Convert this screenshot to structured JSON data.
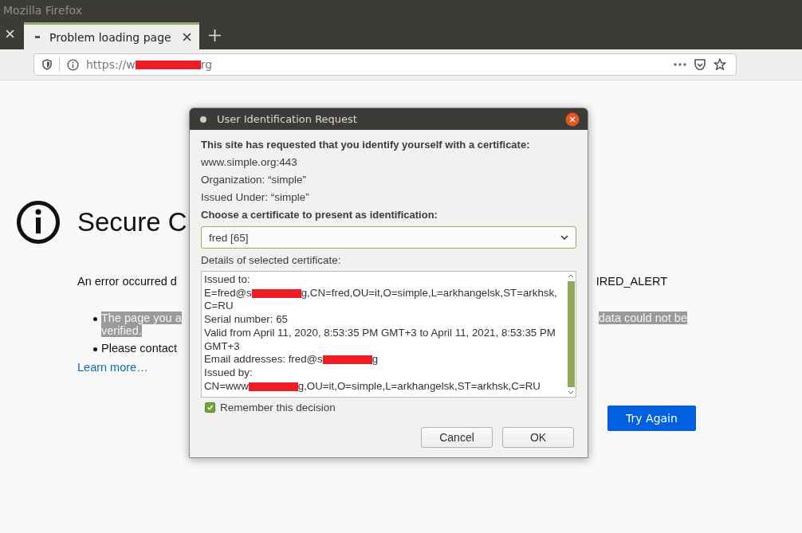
{
  "window": {
    "title": "Mozilla Firefox"
  },
  "tabs": [
    {
      "label": "Problem loading page",
      "selected": true
    }
  ],
  "url": [
    {
      "kind": "text",
      "text": "https://w"
    },
    {
      "kind": "redaction"
    },
    {
      "kind": "text",
      "text": "rg"
    }
  ],
  "page": {
    "title": "Secure C",
    "error_left": "An error occurred d",
    "error_right": "IRED_ALERT",
    "bullets": [
      {
        "left": "The page you a",
        "left_2": "verified.",
        "right": "data could not be",
        "highlighted": true
      },
      {
        "left": "Please contact",
        "highlighted": false
      }
    ],
    "link": "Learn more…",
    "button": "Try Again"
  },
  "dialog": {
    "title": "User Identification Request",
    "heading": "This site has requested that you identify yourself with a certificate:",
    "info": [
      "www.simple.org:443",
      "Organization: “simple”",
      "Issued Under: “simple”"
    ],
    "choose_label": "Choose a certificate to present as identification:",
    "certificate": "fred [65]",
    "details_label": "Details of selected certificate:",
    "details": [
      [
        {
          "kind": "text",
          "text": "Issued to:"
        }
      ],
      [
        {
          "kind": "text",
          "text": "E=fred@s"
        },
        {
          "kind": "redaction"
        },
        {
          "kind": "text",
          "text": "g,CN=fred,OU=it,O=simple,L=arkhangelsk,ST=arkhsk,C=RU"
        }
      ],
      [
        {
          "kind": "text",
          "text": "Serial number: 65"
        }
      ],
      [
        {
          "kind": "text",
          "text": "Valid from April 11, 2020, 8:53:35 PM GMT+3 to April 11, 2021, 8:53:35 PM GMT+3"
        }
      ],
      [
        {
          "kind": "text",
          "text": "Email addresses: fred@s"
        },
        {
          "kind": "redaction"
        },
        {
          "kind": "text",
          "text": "g"
        }
      ],
      [
        {
          "kind": "text",
          "text": "Issued by:"
        }
      ],
      [
        {
          "kind": "text",
          "text": "CN=www"
        },
        {
          "kind": "redaction"
        },
        {
          "kind": "text",
          "text": "g,OU=it,O=simple,L=arkhangelsk,ST=arkhsk,C=RU"
        }
      ]
    ],
    "remember": {
      "label": "Remember this decision",
      "checked": true
    },
    "buttons": [
      "Cancel",
      "OK"
    ]
  }
}
